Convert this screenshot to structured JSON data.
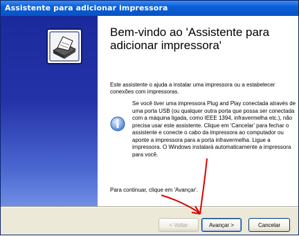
{
  "window": {
    "title": "Assistente para adicionar impressora"
  },
  "content": {
    "heading": "Bem-vindo ao 'Assistente para adicionar impressora'",
    "intro": "Este assistente o ajuda a instalar uma impressora ou a estabelecer conexões com impressoras.",
    "info": "Se você tiver uma impressora Plug and Play conectada através de uma porta USB (ou qualquer outra porta que possa ser conectada com a máquina ligada, como IEEE 1394, infravermelha etc.), não precisa usar este assistente. Clique em 'Cancelar' para fechar o assistente e conecte o cabo da impressora ao computador ou aponte a impressora para a porta infravermelha. Ligue a impressora. O Windows instalará automaticamente a impressora para você.",
    "continue": "Para continuar, clique em 'Avançar'."
  },
  "buttons": {
    "back": "< Voltar",
    "next": "Avançar >",
    "cancel": "Cancelar"
  },
  "colors": {
    "title_bar": "#0a5fd8",
    "left_panel": "#1a2a9c",
    "annotation_arrow": "#d60000"
  },
  "icons": {
    "wizard": "printer-icon",
    "info": "info-icon"
  }
}
